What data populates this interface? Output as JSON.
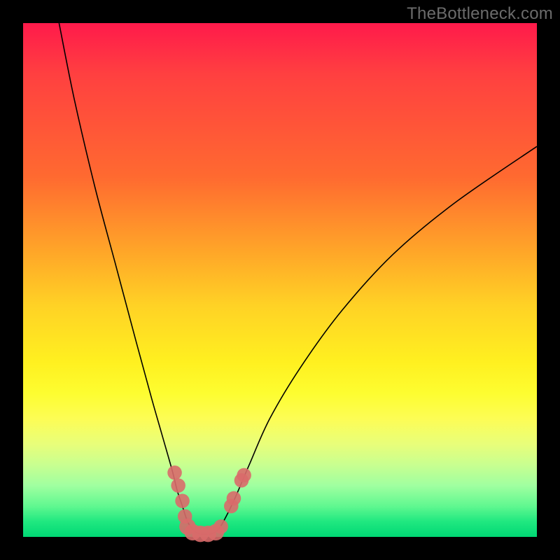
{
  "watermark": {
    "text": "TheBottleneck.com"
  },
  "gradient": {
    "top": "#ff1a4b",
    "mid1": "#ffa828",
    "mid2": "#fff020",
    "bottom": "#00d874"
  },
  "chart_data": {
    "type": "line",
    "title": "",
    "xlabel": "",
    "ylabel": "",
    "xlim": [
      0,
      100
    ],
    "ylim": [
      0,
      100
    ],
    "grid": false,
    "legend": false,
    "series": [
      {
        "name": "curve",
        "x": [
          7,
          10,
          14,
          18,
          22,
          25,
          27,
          29,
          30,
          31,
          32,
          33,
          34,
          35,
          36,
          37,
          38,
          39,
          41,
          44,
          48,
          54,
          62,
          72,
          84,
          100
        ],
        "y": [
          100,
          85,
          68,
          53,
          38,
          27,
          20,
          13,
          9,
          6,
          3,
          1.5,
          0.7,
          0.5,
          0.5,
          0.7,
          1.5,
          3,
          7,
          14,
          23,
          33,
          44,
          55,
          65,
          76
        ]
      }
    ],
    "markers": [
      {
        "x": 29.5,
        "y": 12.5,
        "r": 1.4
      },
      {
        "x": 30.2,
        "y": 10.0,
        "r": 1.4
      },
      {
        "x": 31.0,
        "y": 7.0,
        "r": 1.4
      },
      {
        "x": 31.5,
        "y": 4.0,
        "r": 1.4
      },
      {
        "x": 32.0,
        "y": 2.0,
        "r": 1.6
      },
      {
        "x": 33.0,
        "y": 0.9,
        "r": 1.6
      },
      {
        "x": 34.5,
        "y": 0.6,
        "r": 1.6
      },
      {
        "x": 36.0,
        "y": 0.6,
        "r": 1.6
      },
      {
        "x": 37.5,
        "y": 0.9,
        "r": 1.6
      },
      {
        "x": 38.5,
        "y": 2.0,
        "r": 1.4
      },
      {
        "x": 40.5,
        "y": 6.0,
        "r": 1.4
      },
      {
        "x": 41.0,
        "y": 7.5,
        "r": 1.4
      },
      {
        "x": 42.5,
        "y": 11.0,
        "r": 1.4
      },
      {
        "x": 43.0,
        "y": 12.0,
        "r": 1.4
      }
    ],
    "marker_color": "#d96a6a"
  }
}
